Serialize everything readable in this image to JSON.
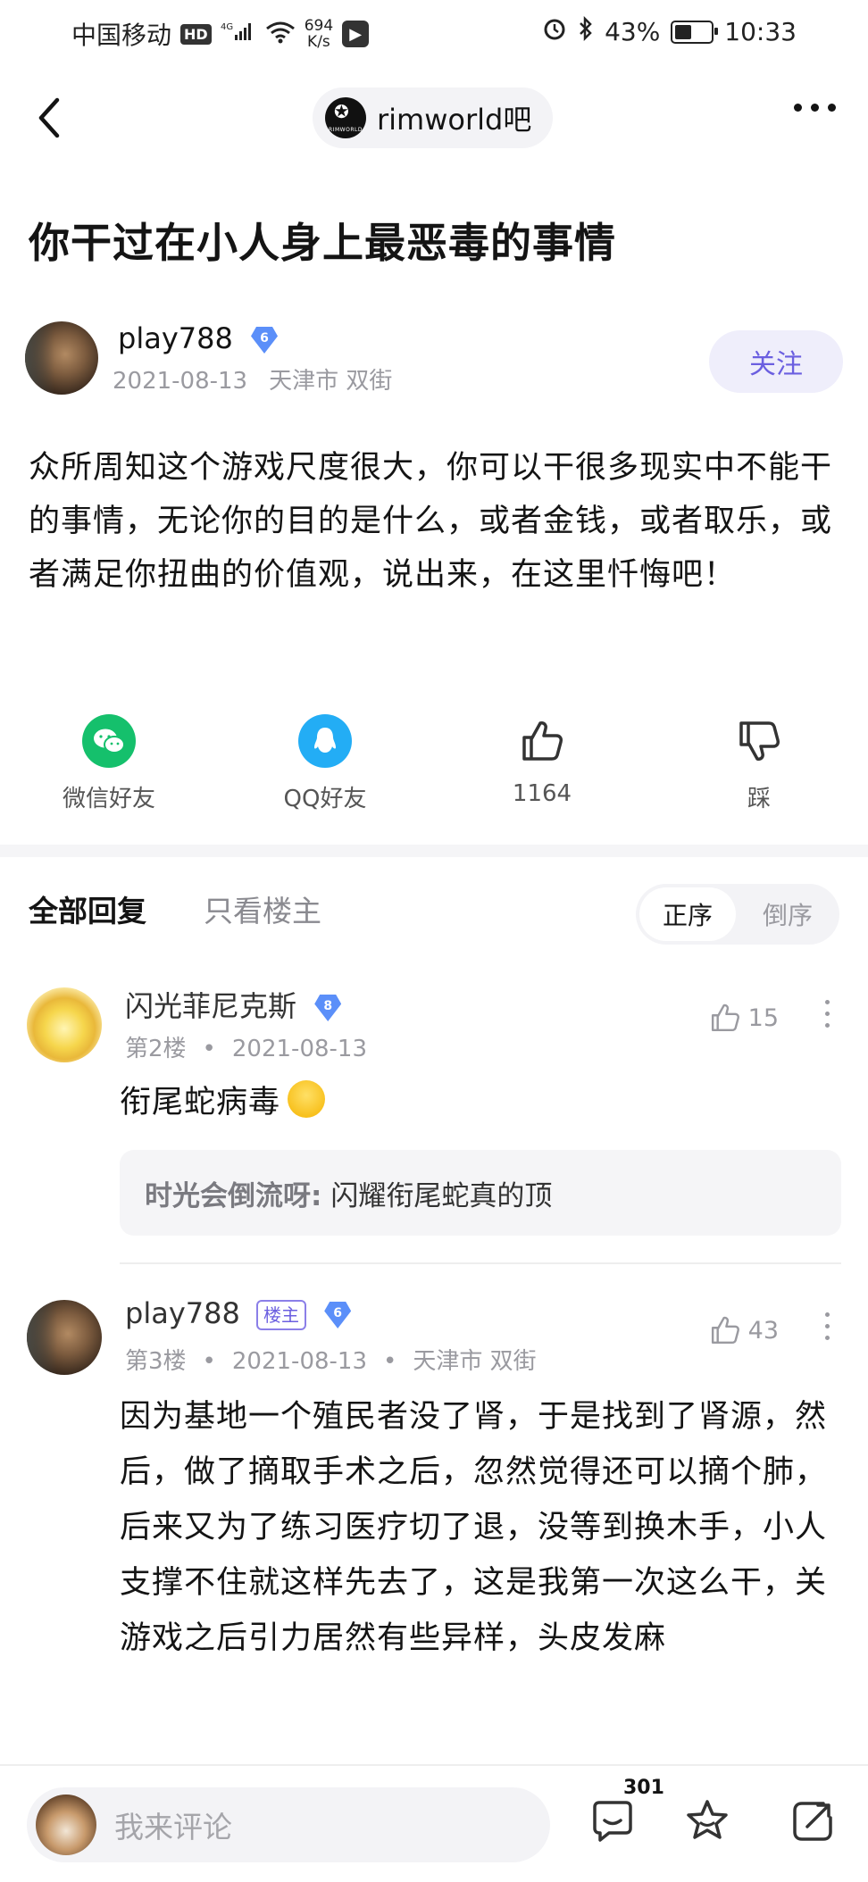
{
  "status_bar": {
    "carrier": "中国移动",
    "hd": "HD",
    "network": "4G",
    "speed_value": "694",
    "speed_unit": "K/s",
    "battery": "43%",
    "time": "10:33"
  },
  "header": {
    "forum_name": "rimworld吧",
    "forum_logo_text": "RIMWORLD"
  },
  "post": {
    "title": "你干过在小人身上最恶毒的事情",
    "author": {
      "name": "play788",
      "level": "6",
      "date": "2021-08-13",
      "location": "天津市 双街"
    },
    "follow_label": "关注",
    "body": "众所周知这个游戏尺度很大，你可以干很多现实中不能干的事情，无论你的目的是什么，或者金钱，或者取乐，或者满足你扭曲的价值观，说出来，在这里忏悔吧！"
  },
  "share": {
    "wechat_label": "微信好友",
    "qq_label": "QQ好友",
    "like_count": "1164",
    "dislike_label": "踩"
  },
  "tabs": {
    "all": "全部回复",
    "op_only": "只看楼主",
    "sort_asc": "正序",
    "sort_desc": "倒序"
  },
  "replies": [
    {
      "name": "闪光菲尼克斯",
      "level": "8",
      "floor": "第2楼",
      "date": "2021-08-13",
      "likes": "15",
      "text": "衔尾蛇病毒",
      "quote": {
        "author": "时光会倒流呀:",
        "text": "闪耀衔尾蛇真的顶"
      }
    },
    {
      "name": "play788",
      "op_tag": "楼主",
      "level": "6",
      "floor": "第3楼",
      "date": "2021-08-13",
      "location": "天津市 双街",
      "likes": "43",
      "text": "因为基地一个殖民者没了肾，于是找到了肾源，然后，做了摘取手术之后，忽然觉得还可以摘个肺，后来又为了练习医疗切了退，没等到换木手，小人支撑不住就这样先去了，这是我第一次这么干，关游戏之后引力居然有些异样，头皮发麻"
    }
  ],
  "bottom_bar": {
    "placeholder": "我来评论",
    "comment_count": "301"
  }
}
